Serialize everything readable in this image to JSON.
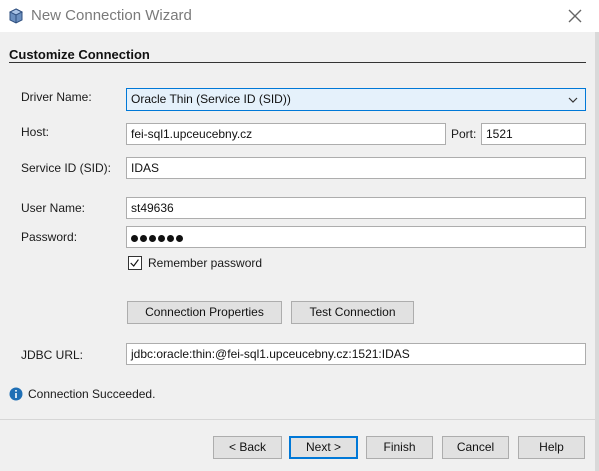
{
  "window": {
    "title": "New Connection Wizard"
  },
  "section": {
    "title": "Customize Connection"
  },
  "form": {
    "driver_label": "Driver Name:",
    "driver_value": "Oracle Thin (Service ID (SID))",
    "host_label": "Host:",
    "host_value": "fei-sql1.upceucebny.cz",
    "port_label": "Port:",
    "port_value": "1521",
    "sid_label": "Service ID (SID):",
    "sid_value": "IDAS",
    "user_label": "User Name:",
    "user_value": "st49636",
    "password_label": "Password:",
    "password_mask_count": 6,
    "remember_label": "Remember password",
    "remember_checked": true,
    "connection_properties_label": "Connection Properties",
    "test_connection_label": "Test Connection",
    "jdbc_label": "JDBC URL:",
    "jdbc_value": "jdbc:oracle:thin:@fei-sql1.upceucebny.cz:1521:IDAS"
  },
  "status": {
    "message": "Connection Succeeded."
  },
  "buttons": {
    "back": "< Back",
    "next": "Next >",
    "finish": "Finish",
    "cancel": "Cancel",
    "help": "Help"
  },
  "colors": {
    "accent": "#0078d7",
    "info": "#1f6fb5"
  }
}
